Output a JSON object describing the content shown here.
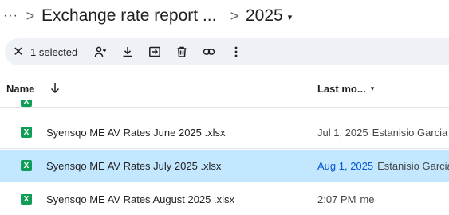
{
  "breadcrumb": {
    "overflow": "···",
    "separator": ">",
    "folder": "Exchange rate report ...",
    "current": "2025",
    "caret": "▾"
  },
  "toolbar": {
    "close_icon": "close-icon",
    "selected_text": "1 selected",
    "actions": [
      "share-icon",
      "download-icon",
      "move-icon",
      "delete-icon",
      "link-icon",
      "more-icon"
    ]
  },
  "table": {
    "name_header": "Name",
    "sort_arrow": "↓",
    "last_modified_header": "Last mo...",
    "last_modified_caret": "▾"
  },
  "files": [
    {
      "name": "Syensqo ME AV Rates June 2025 .xlsx",
      "date": "Jul 1, 2025",
      "user": "Estanisio Garcia",
      "selected": false
    },
    {
      "name": "Syensqo ME AV Rates July 2025 .xlsx",
      "date": "Aug 1, 2025",
      "user": "Estanisio Garcia",
      "selected": true
    },
    {
      "name": "Syensqo ME AV Rates August 2025 .xlsx",
      "date": "2:07 PM",
      "user": "me",
      "selected": false
    }
  ],
  "file_icon_letter": "X",
  "colors": {
    "selected_row": "#c2e7ff",
    "toolbar_bg": "#eef1f6",
    "excel_green": "#0f9d58",
    "link_blue": "#0b57d0"
  }
}
